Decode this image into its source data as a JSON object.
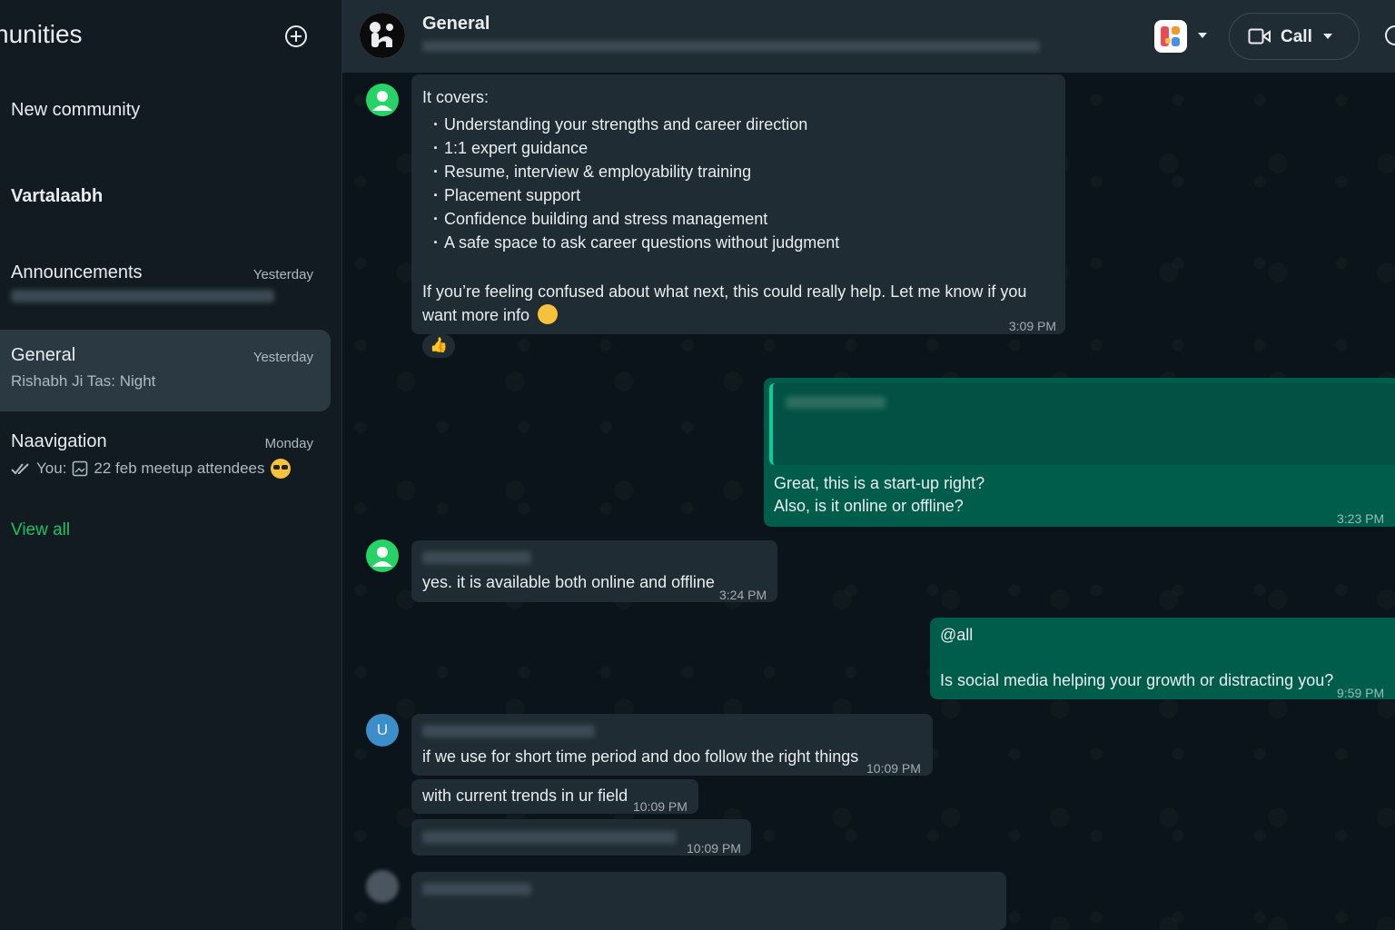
{
  "sidebar": {
    "title": "nunities",
    "new_community": "New community",
    "community_name": "Vartalaabh",
    "groups": [
      {
        "name": "Announcements",
        "time": "Yesterday",
        "preview": ""
      },
      {
        "name": "General",
        "time": "Yesterday",
        "preview": "Rishabh Ji Tas: Night"
      },
      {
        "name": "Naavigation",
        "time": "Monday",
        "preview_prefix": "You:",
        "preview": "22 feb meetup attendees"
      }
    ],
    "view_all": "View all"
  },
  "header": {
    "title": "General",
    "call_label": "Call"
  },
  "messages": {
    "m1": {
      "intro": "It covers:",
      "bullets": [
        "Understanding your strengths and career direction",
        "1:1 expert guidance",
        "Resume, interview & employability training",
        "Placement support",
        "Confidence building and stress management",
        "A safe space to ask career questions without judgment"
      ],
      "body": "If you’re feeling confused about what next, this could really help. Let me know if you want more info",
      "time": "3:09 PM",
      "reaction": "👍"
    },
    "m2": {
      "line1": "Great, this is a start-up right?",
      "line2": "Also, is it online or offline?",
      "time": "3:23 PM"
    },
    "m3": {
      "text": "yes. it is available both online and offline",
      "time": "3:24 PM"
    },
    "m4": {
      "line1": "@all",
      "line2": "Is social media helping your growth or distracting you?",
      "time": "9:59 PM"
    },
    "m5": {
      "avatar_letter": "U",
      "text": "if we use for short time period and doo follow the right things",
      "time": "10:09 PM"
    },
    "m6": {
      "text": "with current trends in ur field",
      "time": "10:09 PM"
    },
    "m7": {
      "time": "10:09 PM"
    }
  },
  "colors": {
    "accent_green": "#21c063",
    "outgoing_bubble": "#005c4b",
    "incoming_bubble": "#202c33",
    "background": "#0b141a"
  },
  "icons": [
    "add-circle-icon",
    "apps-icon",
    "video-call-icon",
    "search-icon",
    "double-check-icon",
    "image-icon",
    "thumbs-up-icon",
    "smile-emoji-icon",
    "sunglasses-emoji-icon"
  ]
}
